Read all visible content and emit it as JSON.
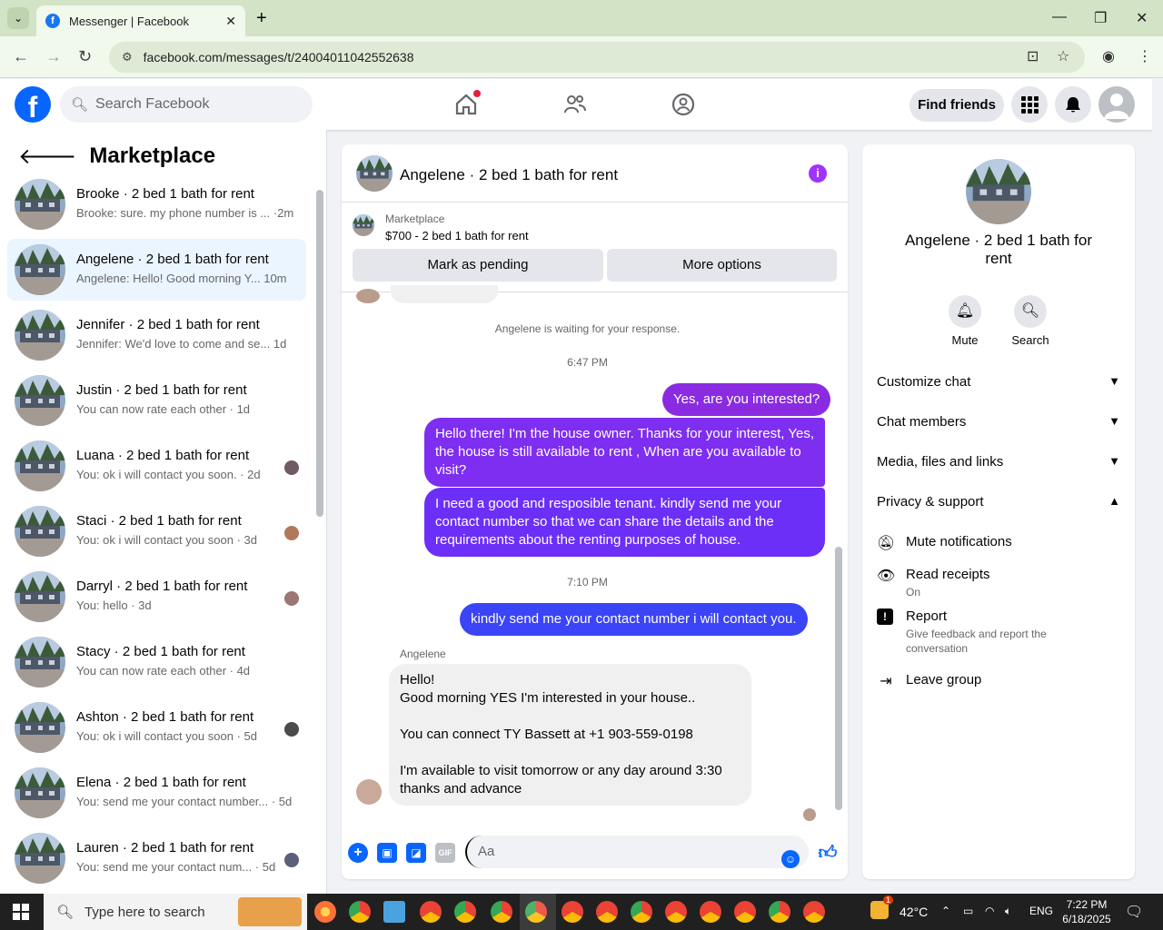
{
  "browser": {
    "tab_title": "Messenger | Facebook",
    "url": "facebook.com/messages/t/24004011042552638"
  },
  "fb_header": {
    "search_placeholder": "Search Facebook",
    "find_friends": "Find friends"
  },
  "sidebar": {
    "title": "Marketplace",
    "conversations": [
      {
        "name": "Brooke · 2 bed 1 bath for rent",
        "preview": "Brooke: sure. my phone number is ... ·2m"
      },
      {
        "name": "Angelene · 2 bed 1 bath for rent",
        "preview": "Angelene: Hello! Good morning Y... 10m"
      },
      {
        "name": "Jennifer · 2 bed 1 bath for rent",
        "preview": "Jennifer: We'd love to come and se... 1d"
      },
      {
        "name": "Justin · 2 bed 1 bath for rent",
        "preview": "You can now rate each other · 1d"
      },
      {
        "name": "Luana · 2 bed 1 bath for rent",
        "preview": "You: ok i will contact you soon. · 2d"
      },
      {
        "name": "Staci · 2 bed 1 bath for rent",
        "preview": "You: ok i will contact you soon · 3d"
      },
      {
        "name": "Darryl · 2 bed 1 bath for rent",
        "preview": "You: hello · 3d"
      },
      {
        "name": "Stacy · 2 bed 1 bath for rent",
        "preview": "You can now rate each other · 4d"
      },
      {
        "name": "Ashton · 2 bed 1 bath for rent",
        "preview": "You: ok i will contact you soon · 5d"
      },
      {
        "name": "Elena · 2 bed 1 bath for rent",
        "preview": "You: send me your contact number... · 5d"
      },
      {
        "name": "Lauren · 2 bed 1 bath for rent",
        "preview": "You: send me your contact num... · 5d"
      }
    ]
  },
  "chat": {
    "title": "Angelene · 2 bed 1 bath for rent",
    "marketplace_label": "Marketplace",
    "listing": "$700 - 2 bed 1 bath for rent",
    "mark_pending": "Mark as pending",
    "more_options": "More options",
    "waiting": "Angelene is waiting for your response.",
    "time1": "6:47 PM",
    "msg1": "Yes, are you interested?",
    "msg2": "Hello there! I'm the house owner. Thanks for your interest, Yes, the house is still available to rent , When are you available to visit?",
    "msg3": "I need a good and resposible tenant.  kindly send me your contact number so that we can share the details and the requirements about the renting purposes of house.",
    "time2": "7:10 PM",
    "msg4": "kindly  send  me your contact number  i will  contact you.",
    "sender": "Angelene",
    "reply": "Hello!\nGood morning YES I'm interested in your house..\n\nYou can connect TY Bassett at +1 903-559-0198\n\nI'm available to visit tomorrow or any day around 3:30 thanks and advance",
    "composer_placeholder": "Aa"
  },
  "details": {
    "name": "Angelene · 2 bed 1 bath for rent",
    "mute": "Mute",
    "search": "Search",
    "customize": "Customize chat",
    "members": "Chat members",
    "media": "Media, files and links",
    "privacy": "Privacy & support",
    "mute_notifications": "Mute notifications",
    "read_receipts": "Read receipts",
    "read_receipts_status": "On",
    "report": "Report",
    "report_sub": "Give feedback and report the conversation",
    "leave": "Leave group"
  },
  "taskbar": {
    "search": "Type here to search",
    "temp": "42°C",
    "weather_badge": "1",
    "lang": "ENG",
    "time": "7:22 PM",
    "date": "6/18/2025"
  },
  "colors": {
    "accent": "#0866ff",
    "bubble_out": "#7b2ff7",
    "info": "#a033ff"
  }
}
